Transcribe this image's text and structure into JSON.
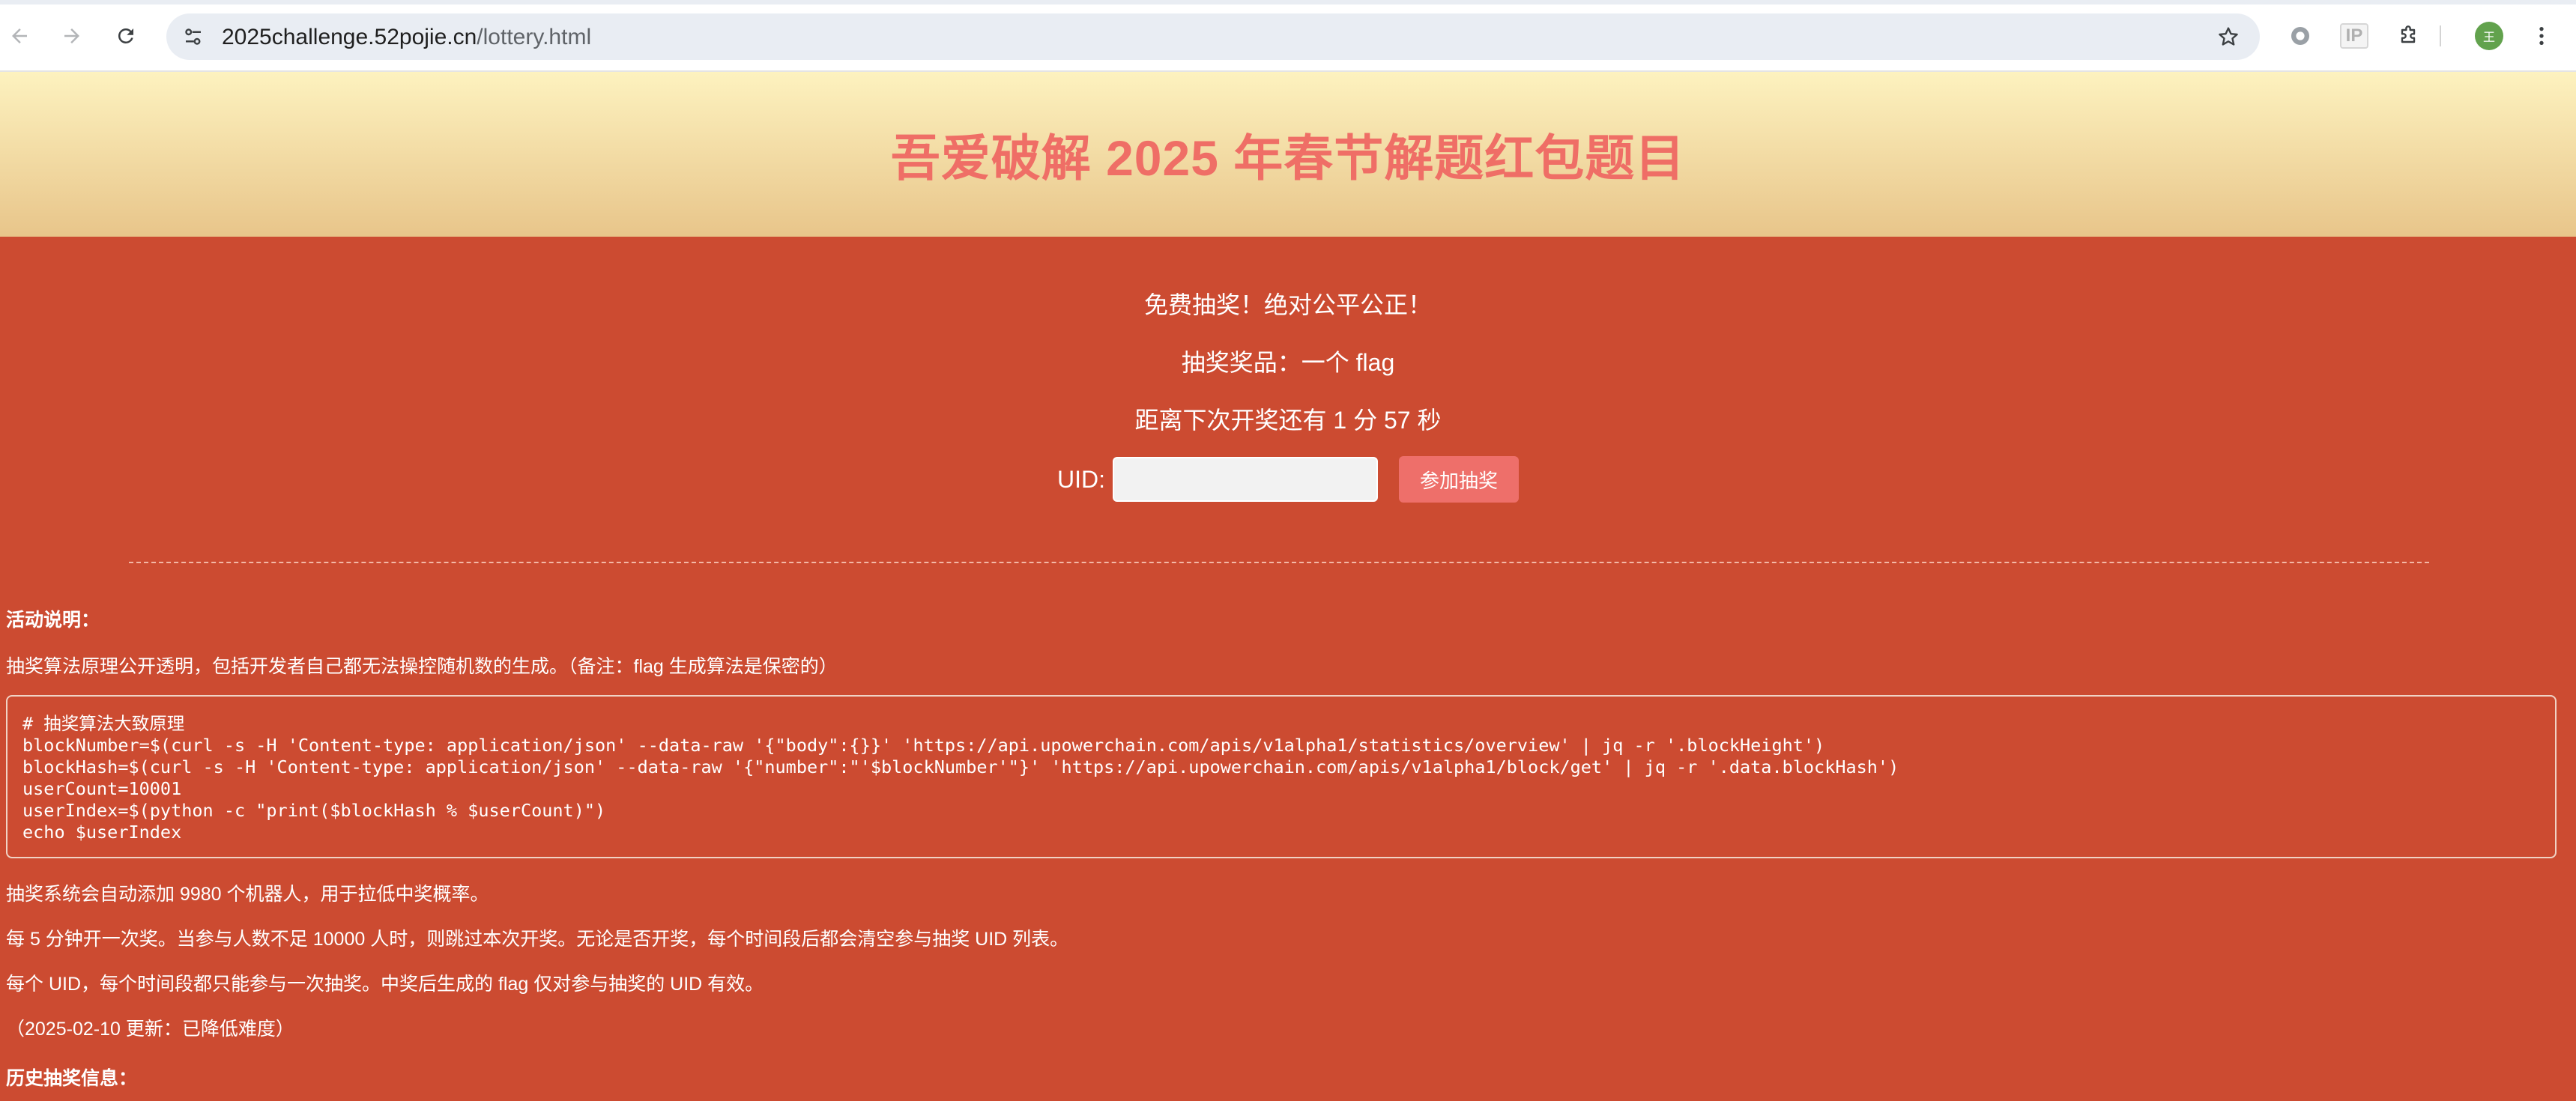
{
  "browser": {
    "url_host": "2025challenge.52pojie.cn",
    "url_path": "/lottery.html",
    "ip_extension_label": "IP",
    "avatar_initial": "王"
  },
  "page": {
    "title": "吾爱破解 2025 年春节解题红包题目",
    "free_draw": "免费抽奖！绝对公平公正！",
    "prize": "抽奖奖品：一个 flag",
    "countdown": "距离下次开奖还有 1 分 57 秒",
    "uid_label": "UID:",
    "uid_value": "",
    "join_button": "参加抽奖"
  },
  "description": {
    "heading": "活动说明：",
    "intro": "抽奖算法原理公开透明，包括开发者自己都无法操控随机数的生成。（备注：flag 生成算法是保密的）",
    "code_lines": [
      "# 抽奖算法大致原理",
      "blockNumber=$(curl -s -H 'Content-type: application/json' --data-raw '{\"body\":{}}' 'https://api.upowerchain.com/apis/v1alpha1/statistics/overview' | jq -r '.blockHeight')",
      "blockHash=$(curl -s -H 'Content-type: application/json' --data-raw '{\"number\":\"'$blockNumber'\"}' 'https://api.upowerchain.com/apis/v1alpha1/block/get' | jq -r '.data.blockHash')",
      "userCount=10001",
      "userIndex=$(python -c \"print($blockHash % $userCount)\")",
      "echo $userIndex"
    ],
    "robots": "抽奖系统会自动添加 9980 个机器人，用于拉低中奖概率。",
    "schedule": "每 5 分钟开一次奖。当参与人数不足 10000 人时，则跳过本次开奖。无论是否开奖，每个时间段后都会清空参与抽奖 UID 列表。",
    "rule": "每个 UID，每个时间段都只能参与一次抽奖。中奖后生成的 flag 仅对参与抽奖的 UID 有效。",
    "update": "（2025-02-10 更新：已降低难度）",
    "history_heading": "历史抽奖信息："
  },
  "colors": {
    "page_background": "#cc4b31",
    "title_color": "#ef6e66",
    "button_color": "#ee6f6a",
    "header_gradient_top": "#fdf2bf",
    "header_gradient_bottom": "#e8c58a"
  }
}
